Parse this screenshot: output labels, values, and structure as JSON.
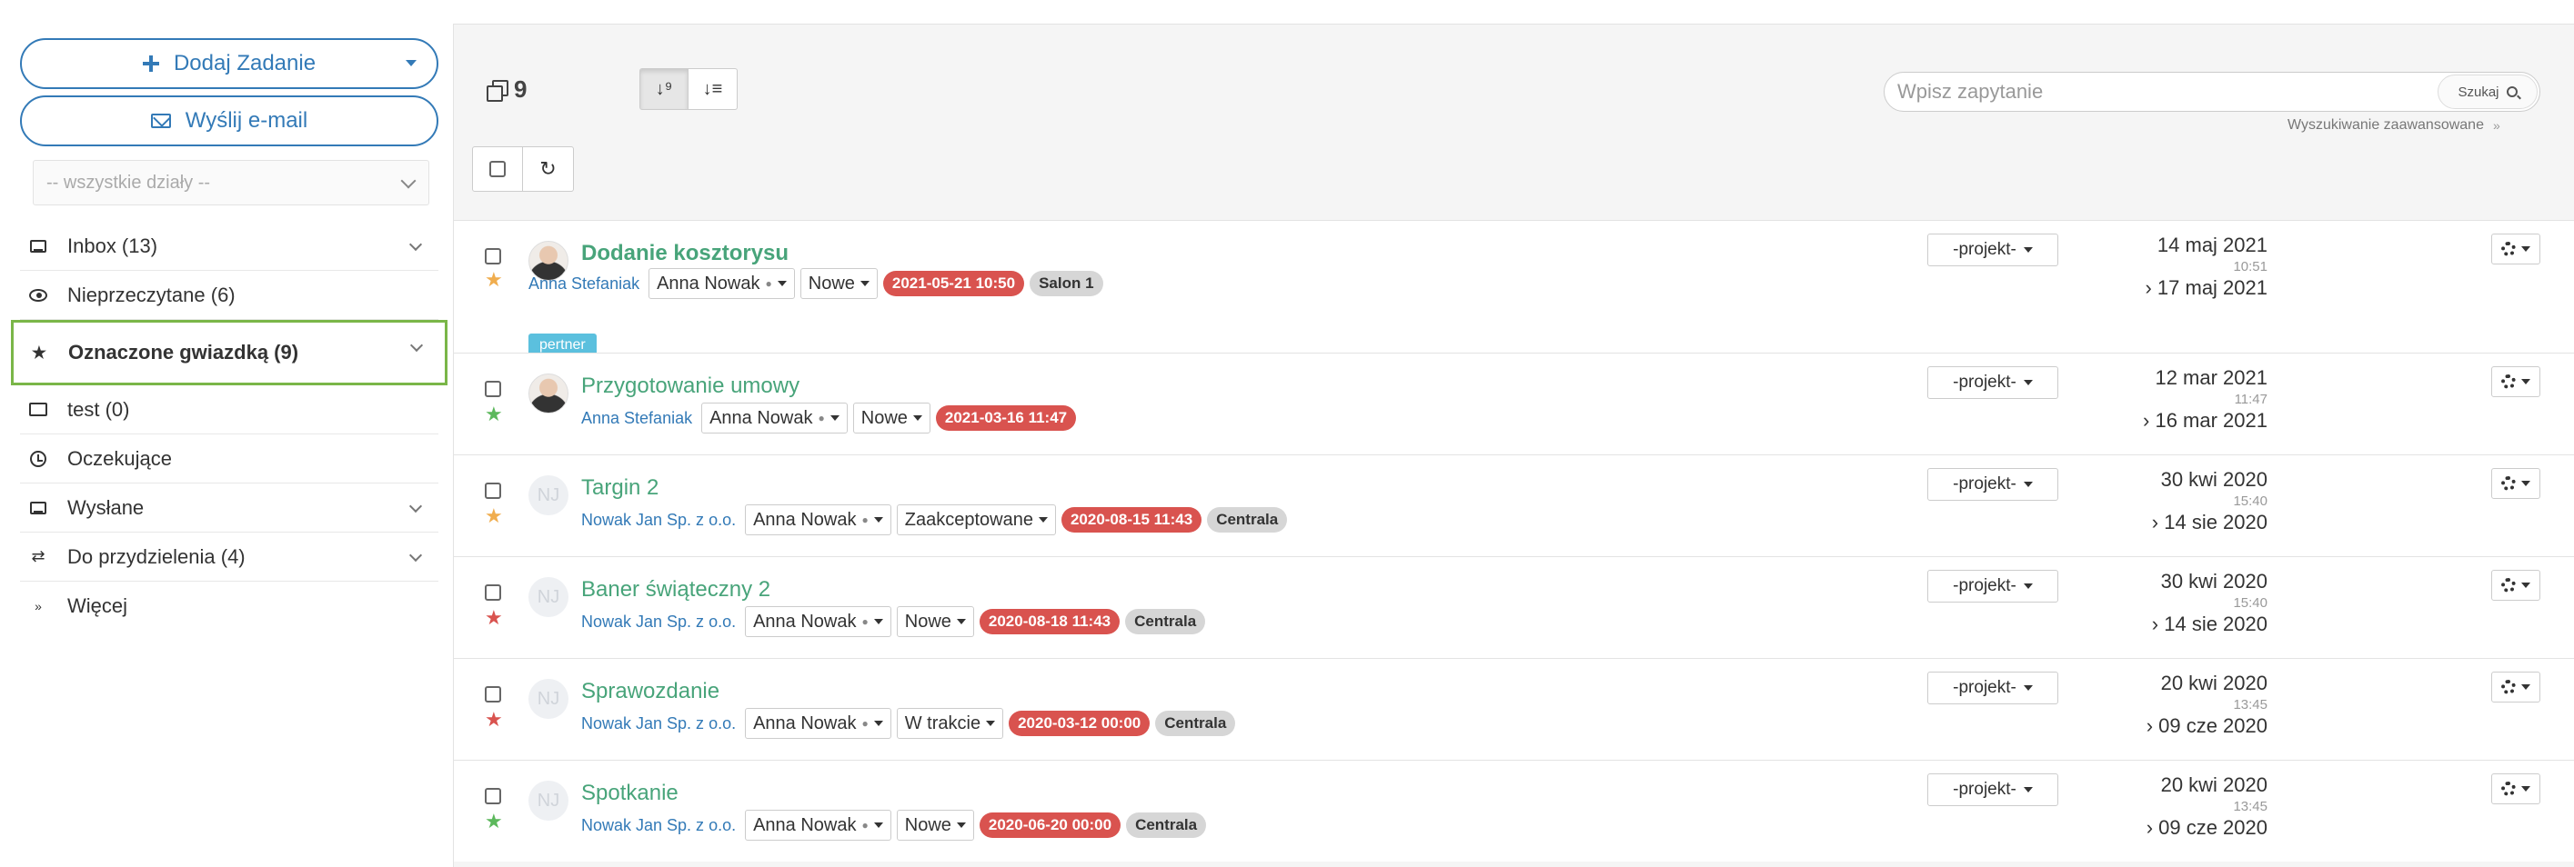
{
  "sidebar": {
    "add_task_label": "Dodaj Zadanie",
    "send_email_label": "Wyślij e-mail",
    "department_select": "-- wszystkie działy --",
    "items": [
      {
        "label": "Inbox (13)",
        "icon": "inbox-icon",
        "expandable": true
      },
      {
        "label": "Nieprzeczytane (6)",
        "icon": "eye-icon",
        "expandable": false
      },
      {
        "label": "Oznaczone gwiazdką (9)",
        "icon": "star-icon",
        "expandable": true,
        "active": true
      },
      {
        "label": "test (0)",
        "icon": "folder-icon",
        "expandable": false
      },
      {
        "label": "Oczekujące",
        "icon": "clock-icon",
        "expandable": false
      },
      {
        "label": "Wysłane",
        "icon": "inbox-icon",
        "expandable": true
      },
      {
        "label": "Do przydzielenia (4)",
        "icon": "exchange-icon",
        "expandable": true
      },
      {
        "label": "Więcej",
        "icon": "double-chevron-icon",
        "expandable": false
      }
    ],
    "active_color": "#7ab648"
  },
  "toolbar": {
    "count": "9",
    "search_placeholder": "Wpisz zapytanie",
    "search_button": "Szukaj",
    "advanced_search": "Wyszukiwanie zaawansowane"
  },
  "colors": {
    "accent": "#337ab7",
    "title_green": "#48a47a",
    "date_badge": "#d9534f",
    "star_yellow": "#f0ad4e",
    "star_green": "#5cb85c",
    "star_red": "#d9534f"
  },
  "tasks": [
    {
      "title": "Dodanie kosztorysu",
      "bold": true,
      "avatar": "photo",
      "star": "yellow",
      "company": "Anna Stefaniak",
      "assignee": "Anna Nowak",
      "status": "Nowe",
      "deadline": "2021-05-21 10:50",
      "location": "Salon 1",
      "tag": "pertner",
      "project": "-projekt-",
      "date1": "14 maj 2021",
      "time1": "10:51",
      "date2": "› 17 maj 2021"
    },
    {
      "title": "Przygotowanie umowy",
      "bold": false,
      "avatar": "photo",
      "star": "green",
      "company": "Anna Stefaniak",
      "assignee": "Anna Nowak",
      "status": "Nowe",
      "deadline": "2021-03-16 11:47",
      "location": "",
      "tag": "",
      "project": "-projekt-",
      "date1": "12 mar 2021",
      "time1": "11:47",
      "date2": "› 16 mar 2021"
    },
    {
      "title": "Targin 2",
      "bold": false,
      "avatar": "NJ",
      "star": "yellow",
      "company": "Nowak Jan Sp. z o.o.",
      "assignee": "Anna Nowak",
      "status": "Zaakceptowane",
      "deadline": "2020-08-15 11:43",
      "location": "Centrala",
      "tag": "",
      "project": "-projekt-",
      "date1": "30 kwi 2020",
      "time1": "15:40",
      "date2": "› 14 sie 2020"
    },
    {
      "title": "Baner świąteczny 2",
      "bold": false,
      "avatar": "NJ",
      "star": "red",
      "company": "Nowak Jan Sp. z o.o.",
      "assignee": "Anna Nowak",
      "status": "Nowe",
      "deadline": "2020-08-18 11:43",
      "location": "Centrala",
      "tag": "",
      "project": "-projekt-",
      "date1": "30 kwi 2020",
      "time1": "15:40",
      "date2": "› 14 sie 2020"
    },
    {
      "title": "Sprawozdanie",
      "bold": false,
      "avatar": "NJ",
      "star": "red",
      "company": "Nowak Jan Sp. z o.o.",
      "assignee": "Anna Nowak",
      "status": "W trakcie",
      "deadline": "2020-03-12 00:00",
      "location": "Centrala",
      "tag": "",
      "project": "-projekt-",
      "date1": "20 kwi 2020",
      "time1": "13:45",
      "date2": "› 09 cze 2020"
    },
    {
      "title": "Spotkanie",
      "bold": false,
      "avatar": "NJ",
      "star": "green",
      "company": "Nowak Jan Sp. z o.o.",
      "assignee": "Anna Nowak",
      "status": "Nowe",
      "deadline": "2020-06-20 00:00",
      "location": "Centrala",
      "tag": "",
      "project": "-projekt-",
      "date1": "20 kwi 2020",
      "time1": "13:45",
      "date2": "› 09 cze 2020"
    }
  ]
}
